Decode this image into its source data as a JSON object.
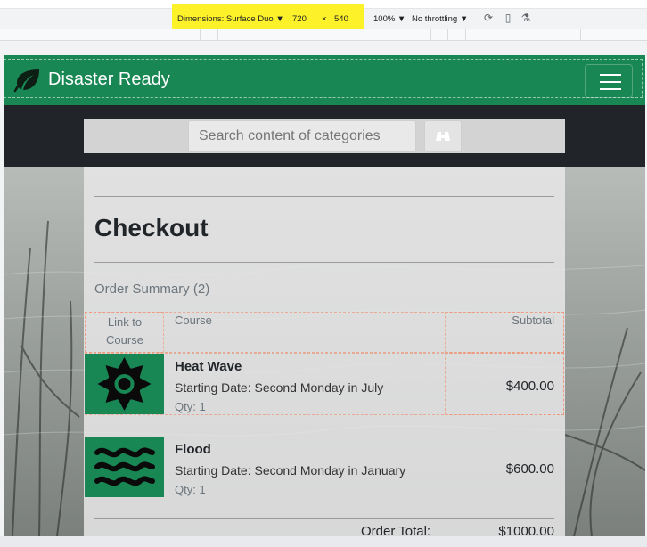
{
  "devtools": {
    "device_label": "Dimensions: Surface Duo ▼",
    "width": "720",
    "times": "×",
    "height": "540",
    "zoom": "100% ▼",
    "throttling": "No throttling ▼"
  },
  "navbar": {
    "brand": "Disaster Ready",
    "color": "#198754"
  },
  "search": {
    "placeholder": "Search content of categories"
  },
  "checkout": {
    "title": "Checkout",
    "summary": "Order Summary (2)",
    "headers": {
      "link": "Link to Course",
      "course": "Course",
      "subtotal": "Subtotal"
    },
    "items": [
      {
        "name": "Heat Wave",
        "date": "Starting Date: Second Monday in July",
        "qty": "Qty: 1",
        "price": "$400.00",
        "icon": "sun-icon"
      },
      {
        "name": "Flood",
        "date": "Starting Date: Second Monday in January",
        "qty": "Qty: 1",
        "price": "$600.00",
        "icon": "waves-icon"
      }
    ],
    "total_label": "Order Total:",
    "total_value": "$1000.00"
  }
}
